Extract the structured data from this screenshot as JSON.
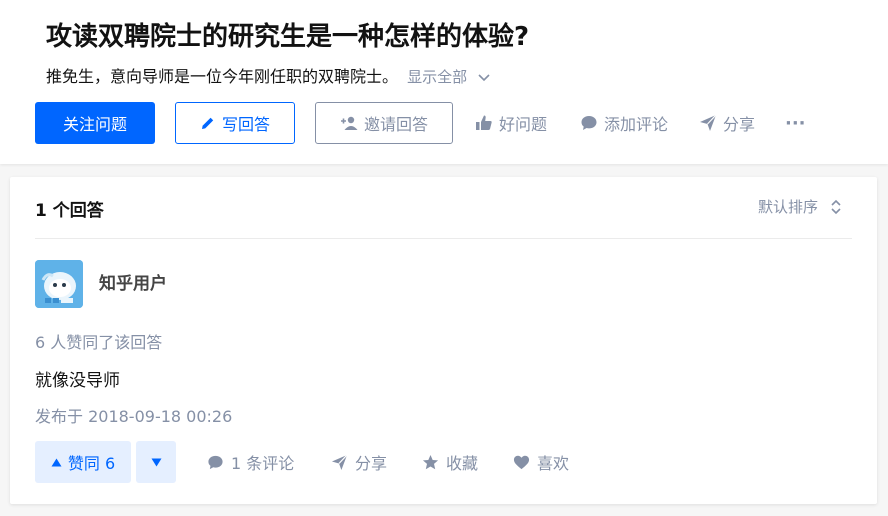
{
  "question": {
    "title": "攻读双聘院士的研究生是一种怎样的体验?",
    "detail": "推免生，意向导师是一位今年刚任职的双聘院士。",
    "show_all": "显示全部",
    "buttons": {
      "follow": "关注问题",
      "write": "写回答",
      "invite": "邀请回答",
      "good_question": "好问题",
      "comment": "添加评论",
      "share": "分享",
      "more": "···"
    }
  },
  "answers": {
    "count_label": "1 个回答",
    "sort_label": "默认排序",
    "items": [
      {
        "author": "知乎用户",
        "votes_text": "6 人赞同了该回答",
        "content": "就像没导师",
        "published": "发布于 2018-09-18 00:26",
        "actions": {
          "upvote": "赞同 6",
          "comments": "1 条评论",
          "share": "分享",
          "collect": "收藏",
          "like": "喜欢"
        }
      }
    ]
  },
  "colors": {
    "brand_blue": "#0066ff",
    "muted_gray": "#8590a6",
    "vote_bg": "#e5efff"
  }
}
